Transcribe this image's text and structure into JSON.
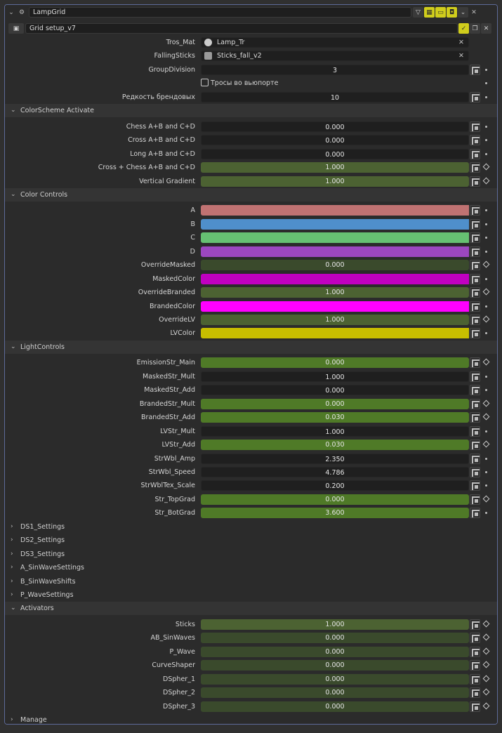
{
  "header": {
    "object_name": "LampGrid",
    "nodegroup_name": "Grid setup_v7"
  },
  "props_top": [
    {
      "label": "Tros_Mat",
      "type": "object",
      "value": "Lamp_Tr",
      "icon": "material-sphere-icon"
    },
    {
      "label": "FallingSticks",
      "type": "object",
      "value": "Sticks_fall_v2",
      "icon": "collection-icon"
    },
    {
      "label": "GroupDivision",
      "type": "number",
      "value": "3"
    },
    {
      "label": "",
      "type": "checkbox",
      "value": "Тросы во вьюпорте"
    },
    {
      "label": "Редкость брендовых",
      "type": "number",
      "value": "10"
    }
  ],
  "sections": {
    "color_scheme": {
      "title": "ColorScheme Activate",
      "rows": [
        {
          "label": "Chess A+B and C+D",
          "value": "0.000"
        },
        {
          "label": "Cross A+B and C+D",
          "value": "0.000"
        },
        {
          "label": "Long A+B and C+D",
          "value": "0.000"
        },
        {
          "label": "Cross + Chess  A+B and C+D",
          "value": "1.000"
        },
        {
          "label": "Vertical Gradient",
          "value": "1.000"
        }
      ]
    },
    "color_controls": {
      "title": "Color Controls",
      "rows": [
        {
          "label": "A",
          "color": "#c07272"
        },
        {
          "label": "B",
          "color": "#4f8fcb"
        },
        {
          "label": "C",
          "color": "#66c172"
        },
        {
          "label": "D",
          "color": "#9c47c0"
        },
        {
          "label": "OverrideMasked",
          "value": "0.000"
        },
        {
          "label": "MaskedColor",
          "color": "#c000c0"
        },
        {
          "label": "OverrideBranded",
          "value": "1.000"
        },
        {
          "label": "BrandedColor",
          "color": "#ff00ff"
        },
        {
          "label": "OverrideLV",
          "value": "1.000"
        },
        {
          "label": "LVColor",
          "color": "#c8be00"
        }
      ]
    },
    "light_controls": {
      "title": "LightControls",
      "rows": [
        {
          "label": "EmissionStr_Main",
          "value": "0.000"
        },
        {
          "label": "MaskedStr_Mult",
          "value": "1.000"
        },
        {
          "label": "MaskedStr_Add",
          "value": "0.000"
        },
        {
          "label": "BrandedStr_Mult",
          "value": "0.000"
        },
        {
          "label": "BrandedStr_Add",
          "value": "0.030"
        },
        {
          "label": "LVStr_Mult",
          "value": "1.000"
        },
        {
          "label": "LVStr_Add",
          "value": "0.030"
        },
        {
          "label": "StrWbl_Amp",
          "value": "2.350"
        },
        {
          "label": "StrWbl_Speed",
          "value": "4.786"
        },
        {
          "label": "StrWblTex_Scale",
          "value": "0.200"
        },
        {
          "label": "Str_TopGrad",
          "value": "0.000"
        },
        {
          "label": "Str_BotGrad",
          "value": "3.600"
        }
      ]
    },
    "collapsed": [
      "DS1_Settings",
      "DS2_Settings",
      "DS3_Settings",
      "A_SinWaveSettings",
      "B_SinWaveShifts",
      "P_WaveSettings"
    ],
    "activators": {
      "title": "Activators",
      "rows": [
        {
          "label": "Sticks",
          "value": "1.000"
        },
        {
          "label": "AB_SinWaves",
          "value": "0.000"
        },
        {
          "label": "P_Wave",
          "value": "0.000"
        },
        {
          "label": "CurveShaper",
          "value": "0.000"
        },
        {
          "label": "DSpher_1",
          "value": "0.000"
        },
        {
          "label": "DSpher_2",
          "value": "0.000"
        },
        {
          "label": "DSpher_3",
          "value": "0.000"
        }
      ]
    },
    "manage": {
      "title": "Manage"
    }
  },
  "colors": {
    "panel_bg": "#2b2b2b",
    "field_dark": "#1f1f1f",
    "field_driven": "#4c6232",
    "accent_yellow": "#d0cd1c",
    "border_blue": "#5d6a99"
  }
}
